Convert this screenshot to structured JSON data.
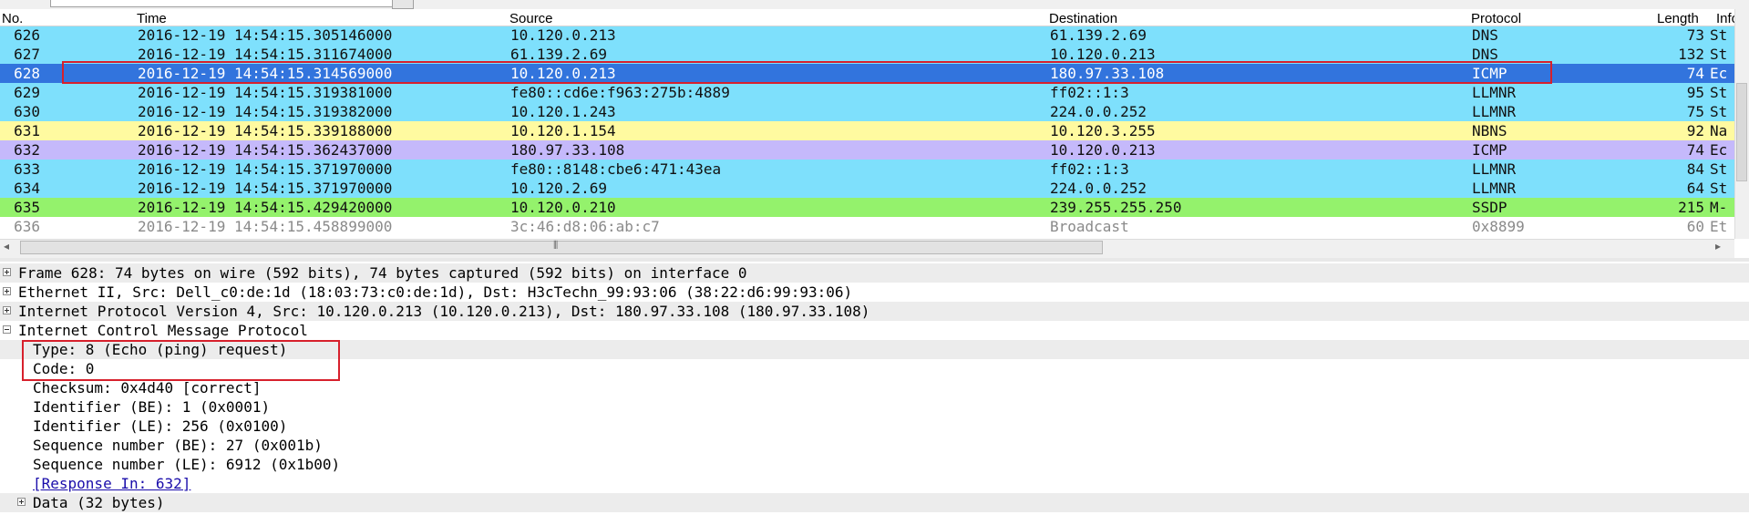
{
  "columns": {
    "no": "No.",
    "time": "Time",
    "source": "Source",
    "destination": "Destination",
    "protocol": "Protocol",
    "length": "Length",
    "info": "Info"
  },
  "colors": {
    "dns": "#7ee0fc",
    "icmp": "#c5b9fb",
    "selected": "#3274dd",
    "llmnr": "#7ee0fc",
    "nbns": "#fffaa0",
    "ssdp": "#94f26c",
    "other": "#ffffff",
    "highlight_box": "#d7202c"
  },
  "packets": [
    {
      "no": "626",
      "time": "2016-12-19  14:54:15.305146000",
      "source": "10.120.0.213",
      "destination": "61.139.2.69",
      "protocol": "DNS",
      "length": "73",
      "info": "St"
    },
    {
      "no": "627",
      "time": "2016-12-19  14:54:15.311674000",
      "source": "61.139.2.69",
      "destination": "10.120.0.213",
      "protocol": "DNS",
      "length": "132",
      "info": "St"
    },
    {
      "no": "628",
      "time": "2016-12-19  14:54:15.314569000",
      "source": "10.120.0.213",
      "destination": "180.97.33.108",
      "protocol": "ICMP",
      "length": "74",
      "info": "Ec"
    },
    {
      "no": "629",
      "time": "2016-12-19  14:54:15.319381000",
      "source": "fe80::cd6e:f963:275b:4889",
      "destination": "ff02::1:3",
      "protocol": "LLMNR",
      "length": "95",
      "info": "St"
    },
    {
      "no": "630",
      "time": "2016-12-19  14:54:15.319382000",
      "source": "10.120.1.243",
      "destination": "224.0.0.252",
      "protocol": "LLMNR",
      "length": "75",
      "info": "St"
    },
    {
      "no": "631",
      "time": "2016-12-19  14:54:15.339188000",
      "source": "10.120.1.154",
      "destination": "10.120.3.255",
      "protocol": "NBNS",
      "length": "92",
      "info": "Na"
    },
    {
      "no": "632",
      "time": "2016-12-19  14:54:15.362437000",
      "source": "180.97.33.108",
      "destination": "10.120.0.213",
      "protocol": "ICMP",
      "length": "74",
      "info": "Ec"
    },
    {
      "no": "633",
      "time": "2016-12-19  14:54:15.371970000",
      "source": "fe80::8148:cbe6:471:43ea",
      "destination": "ff02::1:3",
      "protocol": "LLMNR",
      "length": "84",
      "info": "St"
    },
    {
      "no": "634",
      "time": "2016-12-19  14:54:15.371970000",
      "source": "10.120.2.69",
      "destination": "224.0.0.252",
      "protocol": "LLMNR",
      "length": "64",
      "info": "St"
    },
    {
      "no": "635",
      "time": "2016-12-19  14:54:15.429420000",
      "source": "10.120.0.210",
      "destination": "239.255.255.250",
      "protocol": "SSDP",
      "length": "215",
      "info": "M-"
    },
    {
      "no": "636",
      "time": "2016-12-19  14:54:15.458899000",
      "source": "3c:46:d8:06:ab:c7",
      "destination": "Broadcast",
      "protocol": "0x8899",
      "length": "60",
      "info": "Et"
    }
  ],
  "selected_packet": "628",
  "details": [
    {
      "text": "Frame 628: 74 bytes on wire (592 bits), 74 bytes captured (592 bits) on interface 0",
      "level": 0,
      "expander": "plus"
    },
    {
      "text": "Ethernet II, Src: Dell_c0:de:1d (18:03:73:c0:de:1d), Dst: H3cTechn_99:93:06 (38:22:d6:99:93:06)",
      "level": 0,
      "expander": "plus"
    },
    {
      "text": "Internet Protocol Version 4, Src: 10.120.0.213 (10.120.0.213), Dst: 180.97.33.108 (180.97.33.108)",
      "level": 0,
      "expander": "plus"
    },
    {
      "text": "Internet Control Message Protocol",
      "level": 0,
      "expander": "minus"
    },
    {
      "text": "Type: 8 (Echo (ping) request)",
      "level": 1
    },
    {
      "text": "Code: 0",
      "level": 1
    },
    {
      "text": "Checksum: 0x4d40 [correct]",
      "level": 1
    },
    {
      "text": "Identifier (BE): 1 (0x0001)",
      "level": 1
    },
    {
      "text": "Identifier (LE): 256 (0x0100)",
      "level": 1
    },
    {
      "text": "Sequence number (BE): 27 (0x001b)",
      "level": 1
    },
    {
      "text": "Sequence number (LE): 6912 (0x1b00)",
      "level": 1
    },
    {
      "text": "[Response In: 632]",
      "level": 1,
      "link": true
    },
    {
      "text": "Data (32 bytes)",
      "level": 1,
      "expander": "plus"
    }
  ]
}
